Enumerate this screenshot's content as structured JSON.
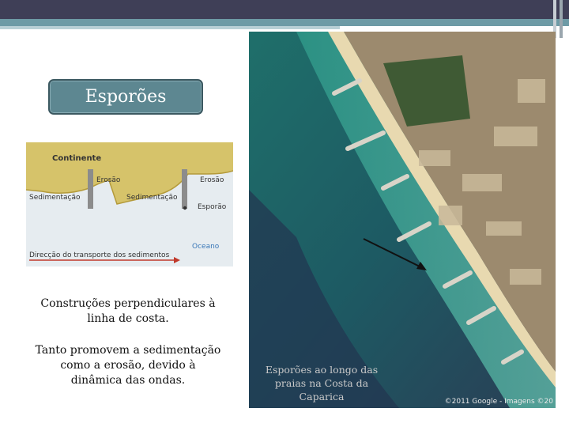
{
  "slide": {
    "title": "Esporões",
    "description_1": "Construções perpendiculares à linha de costa.",
    "description_2": "Tanto promovem a sedimentação como a erosão, devido à dinâmica das ondas."
  },
  "diagram": {
    "labels": {
      "continent": "Continente",
      "erosion_1": "Erosão",
      "erosion_2": "Erosão",
      "sedimentation_1": "Sedimentação",
      "sedimentation_2": "Sedimentação",
      "groyne": "Esporão",
      "ocean": "Oceano",
      "transport": "Direcção do transporte dos sedimentos"
    },
    "colors": {
      "land": "#d6c36a",
      "sea": "#e6ecf0",
      "groyne": "#8c8c8c",
      "transport_arrow": "#c0392b",
      "ocean_text": "#3a78b8"
    }
  },
  "photo": {
    "caption": "Esporões ao longo das praias na Costa da Caparica",
    "credit": "©2011 Google - Imagens ©20"
  },
  "theme": {
    "accent": "#5d8791",
    "header": "#3f3f57"
  }
}
